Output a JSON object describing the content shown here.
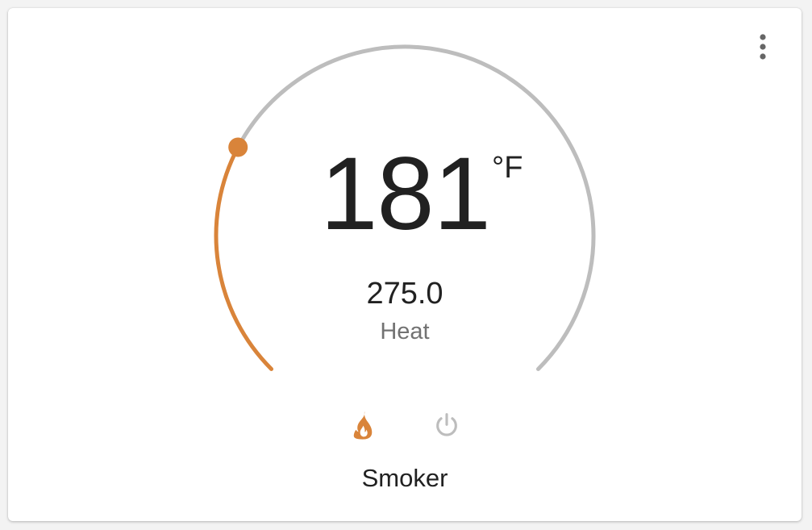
{
  "card": {
    "name": "Smoker",
    "current_temperature": "181",
    "unit": "°F",
    "target_temperature": "275.0",
    "hvac_mode": "Heat",
    "setpoint_fraction": 0.27
  },
  "controls": {
    "menu_icon": "dots-vertical-icon",
    "modes": [
      {
        "name": "heat",
        "icon": "fire-icon",
        "active": true
      },
      {
        "name": "off",
        "icon": "power-icon",
        "active": false
      }
    ]
  },
  "colors": {
    "heat_accent": "#d9843a",
    "track": "#bdbdbd",
    "text_primary": "#212121",
    "text_secondary": "#727272",
    "icon_muted": "#bdbdbd",
    "menu_icon": "#666666"
  }
}
